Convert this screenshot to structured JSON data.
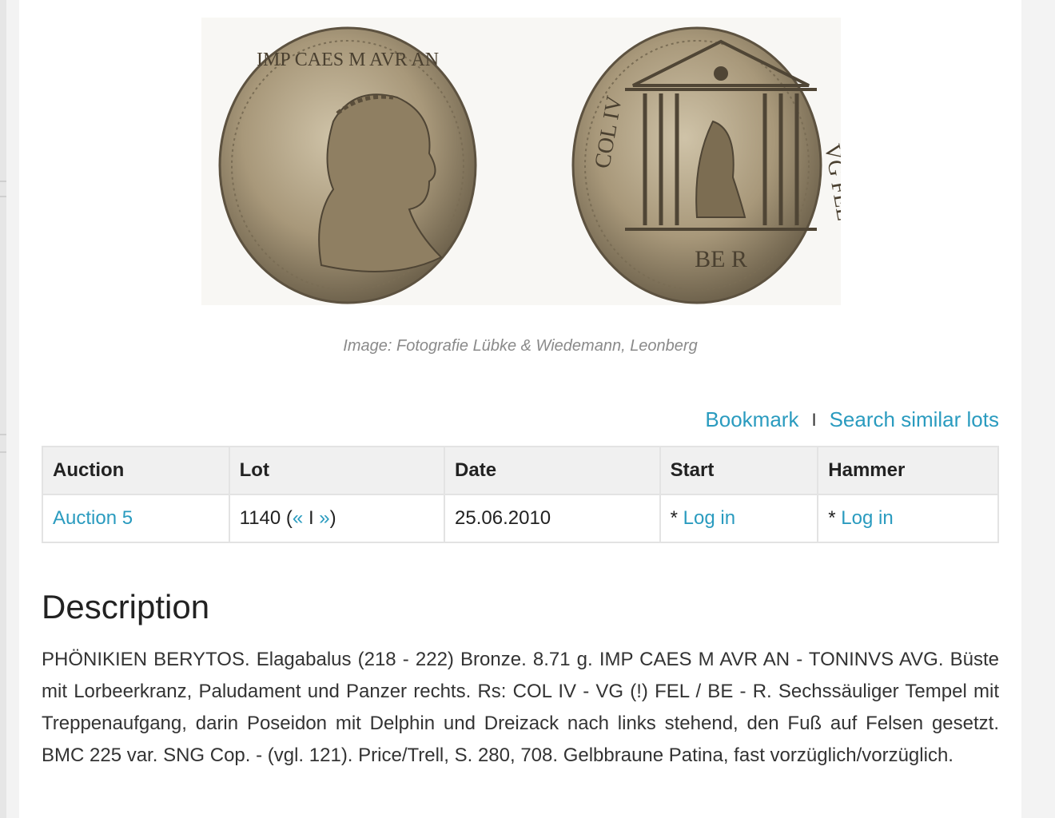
{
  "image_caption": "Image: Fotografie Lübke & Wiedemann, Leonberg",
  "coin_obverse_legend": "IMP CAES M AVR AN",
  "coin_reverse_legend_left": "COL IV",
  "coin_reverse_legend_right": "VG FEL",
  "coin_reverse_exergue": "BE R",
  "actions": {
    "bookmark": "Bookmark",
    "separator": "I",
    "search_similar": "Search similar lots"
  },
  "table": {
    "headers": [
      "Auction",
      "Lot",
      "Date",
      "Start",
      "Hammer"
    ],
    "row": {
      "auction": "Auction 5",
      "lot_number": "1140",
      "lot_open": "(",
      "lot_prev": "«",
      "lot_sep": "I",
      "lot_next": "»",
      "lot_close": ")",
      "date": "25.06.2010",
      "start_prefix": "*",
      "start_link": "Log in",
      "hammer_prefix": "*",
      "hammer_link": "Log in"
    }
  },
  "description": {
    "title": "Description",
    "text": "PHÖNIKIEN BERYTOS. Elagabalus (218 - 222) Bronze. 8.71 g. IMP CAES M AVR AN - TONINVS AVG. Büste mit Lorbeerkranz, Paludament und Panzer rechts. Rs: COL IV - VG (!) FEL / BE - R. Sechssäuliger Tempel mit Treppenaufgang, darin Poseidon mit Delphin und Dreizack nach links stehend, den Fuß auf Felsen gesetzt. BMC 225 var. SNG Cop. - (vgl. 121). Price/Trell, S. 280, 708. Gelbbraune Patina, fast vorzüglich/vorzüglich."
  },
  "colors": {
    "link": "#2a9bbf",
    "coin_bronze": "#a8987a"
  }
}
